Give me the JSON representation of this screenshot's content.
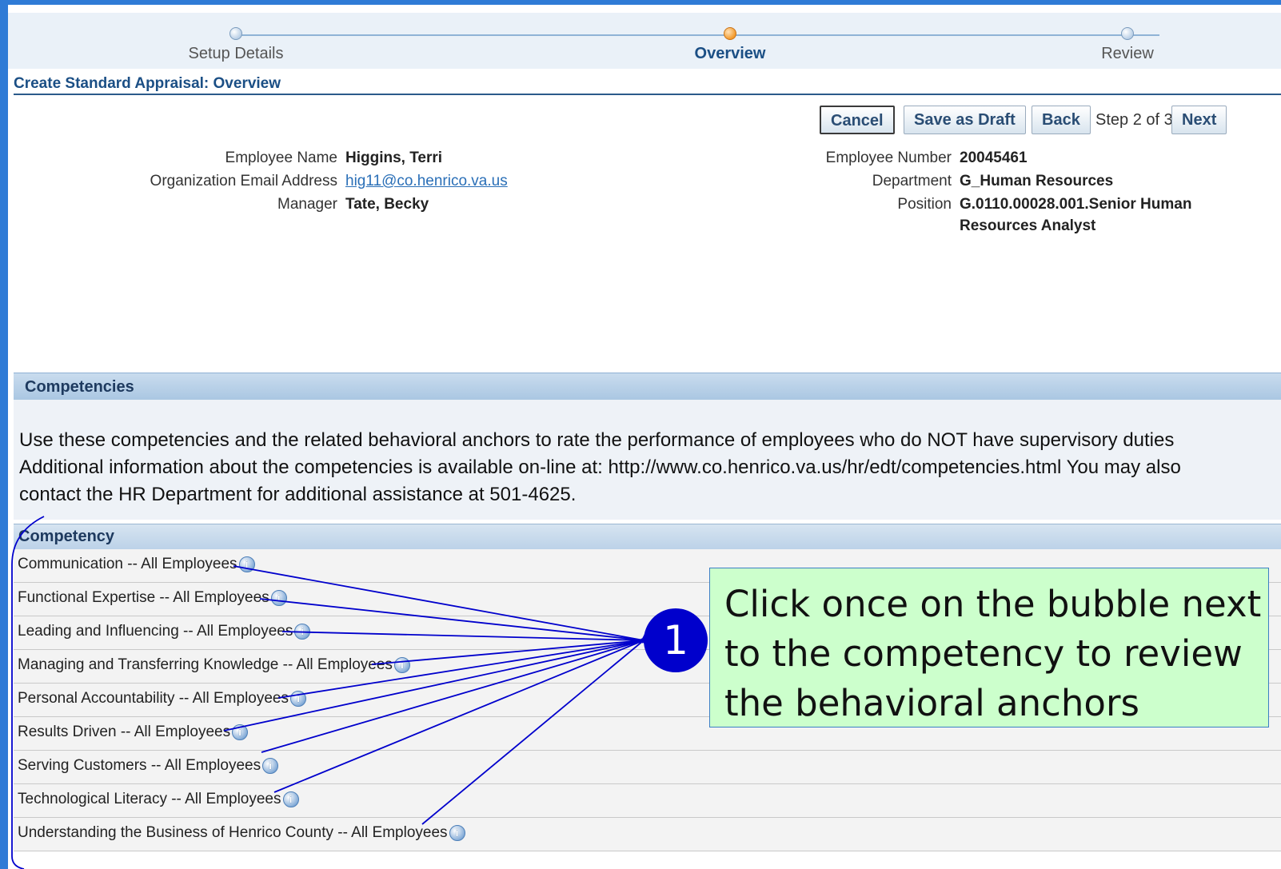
{
  "train": {
    "steps": [
      {
        "label": "Setup Details",
        "state": "visited"
      },
      {
        "label": "Overview",
        "state": "active"
      },
      {
        "label": "Review",
        "state": "upcoming"
      }
    ]
  },
  "page_title": "Create Standard Appraisal: Overview",
  "buttons": {
    "cancel": "Cancel",
    "save_draft": "Save as Draft",
    "back": "Back",
    "step": "Step 2 of 3",
    "next": "Next"
  },
  "employee": {
    "name_label": "Employee Name",
    "name": "Higgins, Terri",
    "email_label": "Organization Email Address",
    "email": "hig11@co.henrico.va.us",
    "manager_label": "Manager",
    "manager": "Tate, Becky",
    "number_label": "Employee Number",
    "number": "20045461",
    "department_label": "Department",
    "department": "G_Human Resources",
    "position_label": "Position",
    "position_line1": "G.0110.00028.001.Senior Human",
    "position_line2": "Resources Analyst"
  },
  "competencies": {
    "header": "Competencies",
    "description": "Use these competencies and the related behavioral anchors to rate the performance of employees who do NOT have supervisory duties Additional information about the competencies is available on-line at: http://www.co.henrico.va.us/hr/edt/competencies.html You may also contact the HR Department for additional assistance at 501-4625.",
    "column_header": "Competency",
    "rows": [
      "Communication -- All Employees",
      "Functional Expertise -- All Employees",
      "Leading and Influencing -- All Employees",
      "Managing and Transferring Knowledge -- All Employees",
      "Personal Accountability -- All Employees",
      "Results Driven -- All Employees",
      "Serving Customers -- All Employees",
      "Technological Literacy -- All Employees",
      "Understanding the Business of Henrico County -- All Employees"
    ]
  },
  "callout": {
    "badge": "1",
    "text": "Click once on the bubble next to the competency to review the behavioral anchors"
  },
  "colors": {
    "accent": "#1b4f85",
    "callout_bg": "#ccffcc",
    "badge": "#0000cc",
    "frame": "#2f7bd6"
  },
  "icons": {
    "train_step": "circle-step-icon",
    "info": "info-bubble-icon"
  }
}
